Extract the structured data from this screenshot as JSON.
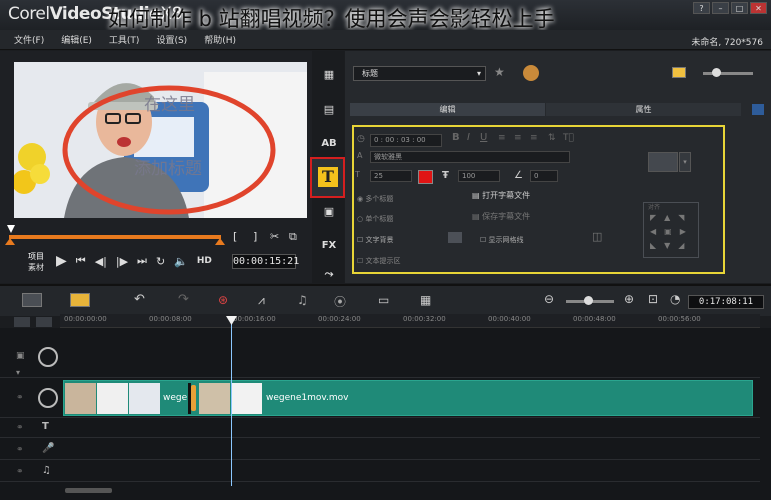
{
  "window": {
    "app_name_light": "Corel",
    "app_name_bold": "VideoStudio",
    "app_version": "X8",
    "overlay_title": "如何制作 b 站翻唱视频？使用会声会影轻松上手",
    "controls": [
      "?",
      "–",
      "□",
      "✕"
    ]
  },
  "menu": {
    "items": [
      "文件(F)",
      "编辑(E)",
      "工具(T)",
      "设置(S)",
      "帮助(H)"
    ],
    "project_info": "未命名, 720*576"
  },
  "preview": {
    "overlay_text_top": "在这里",
    "overlay_text_bottom": "添加标题",
    "mode_project": "项目",
    "mode_clip": "素材",
    "timecode": "00:00:15:21",
    "hd_label": "HD",
    "bracket_in": "[",
    "bracket_out": "]"
  },
  "sidebar": {
    "icons": [
      "media-icon",
      "instant-project-icon",
      "transition-icon",
      "title-icon",
      "graphic-icon",
      "filter-icon",
      "path-icon"
    ],
    "ab_label": "AB",
    "fx_label": "FX"
  },
  "options": {
    "style_label": "标题",
    "tab_edit": "编辑",
    "tab_attr": "属性",
    "duration": "0 : 00 : 03 : 00",
    "font": "微软雅黑",
    "font_size": "25",
    "line_spacing": "100",
    "angle": "0",
    "checkbox_multi_title": "多个标题",
    "checkbox_single_title": "单个标题",
    "checkbox_text_bg": "文字背景",
    "checkbox_show_grid": "显示网格线",
    "checkbox_text_hint": "文本提示区",
    "open_subtitle": "打开字幕文件",
    "save_subtitle": "保存字幕文件",
    "align_label": "对齐"
  },
  "timeline": {
    "ruler_marks": [
      "00:00:00:00",
      "00:00:08:00",
      "00:00:16:00",
      "00:00:24:00",
      "00:00:32:00",
      "00:00:40:00",
      "00:00:48:00",
      "00:00:56:00"
    ],
    "timecode": "0:17:08:11",
    "clips": [
      {
        "name": "wegene1mov.mov"
      },
      {
        "name": "wege"
      }
    ]
  },
  "colors": {
    "accent_orange": "#e87a1e",
    "clip_teal": "#1f8a78",
    "highlight_red": "#d41f1f",
    "highlight_yellow": "#e8d537",
    "text_color_swatch": "#e01414"
  }
}
